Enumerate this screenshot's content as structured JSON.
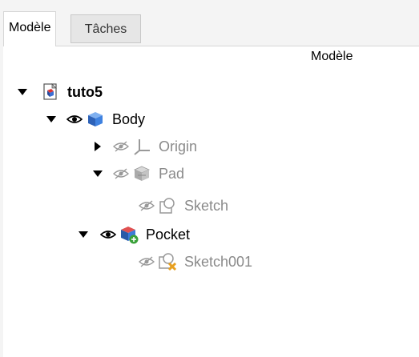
{
  "tabs": [
    {
      "label": "Modèle",
      "active": true
    },
    {
      "label": "Tâches",
      "active": false
    }
  ],
  "tree": {
    "header": "Modèle",
    "items": [
      {
        "label": "tuto5",
        "icon": "document-icon",
        "expanded": true
      },
      {
        "label": "Body",
        "icon": "body-icon",
        "expanded": true,
        "visible": true
      },
      {
        "label": "Origin",
        "icon": "origin-axes-icon",
        "expanded": false,
        "visible": false
      },
      {
        "label": "Pad",
        "icon": "pad-icon",
        "expanded": true,
        "visible": false
      },
      {
        "label": "Sketch",
        "icon": "sketch-icon",
        "visible": false
      },
      {
        "label": "Pocket",
        "icon": "pocket-icon",
        "expanded": true,
        "visible": true
      },
      {
        "label": "Sketch001",
        "icon": "sketch-error-icon",
        "visible": false
      }
    ]
  },
  "colors": {
    "tab_bg": "#f4f4f4",
    "panel_bg": "#ffffff",
    "dim_text": "#8a8a8a",
    "body_blue": "#3b7bd4",
    "error_orange": "#e8a020"
  }
}
